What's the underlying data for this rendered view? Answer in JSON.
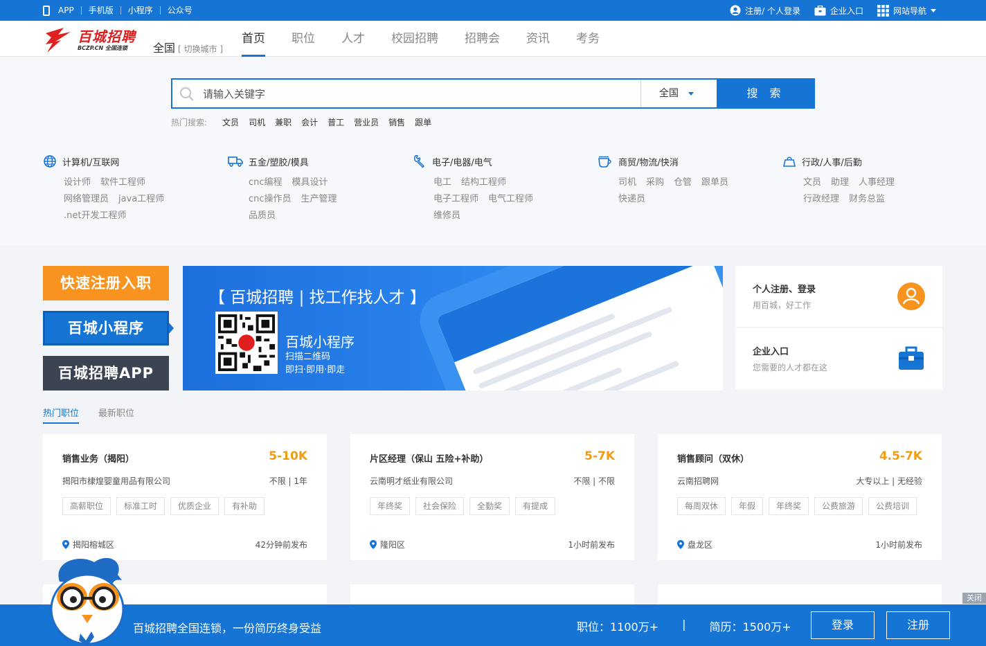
{
  "topbar": {
    "links": [
      "APP",
      "手机版",
      "小程序",
      "公众号"
    ],
    "register_login": "注册/ 个人登录",
    "enterprise": "企业入口",
    "site_nav": "网站导航"
  },
  "header": {
    "logo_text": "百城招聘",
    "logo_sub": "BCZP.CN 全国连锁",
    "city": "全国",
    "switch_city": "[ 切换城市 ]",
    "nav": [
      "首页",
      "职位",
      "人才",
      "校园招聘",
      "招聘会",
      "资讯",
      "考务"
    ]
  },
  "search": {
    "placeholder": "请输入关键字",
    "city": "全国",
    "button": "搜 索",
    "hot_label": "热门搜索:",
    "hot_words": [
      "文员",
      "司机",
      "兼职",
      "会计",
      "普工",
      "营业员",
      "销售",
      "跟单"
    ]
  },
  "categories": [
    {
      "title": "计算机/互联网",
      "icon": "globe-icon",
      "subs": [
        [
          "设计师",
          "软件工程师"
        ],
        [
          "网络管理员",
          "java工程师"
        ],
        [
          ".net开发工程师"
        ]
      ]
    },
    {
      "title": "五金/塑胶/模具",
      "icon": "truck-icon",
      "subs": [
        [
          "cnc编程",
          "模具设计"
        ],
        [
          "cnc操作员",
          "生产管理"
        ],
        [
          "品质员"
        ]
      ]
    },
    {
      "title": "电子/电器/电气",
      "icon": "wrench-icon",
      "subs": [
        [
          "电工",
          "结构工程师"
        ],
        [
          "电子工程师",
          "电气工程师"
        ],
        [
          "维修员"
        ]
      ]
    },
    {
      "title": "商贸/物流/快消",
      "icon": "cup-icon",
      "subs": [
        [
          "司机",
          "采购",
          "仓管",
          "跟单员"
        ],
        [
          "快递员"
        ]
      ]
    },
    {
      "title": "行政/人事/后勤",
      "icon": "bag-icon",
      "subs": [
        [
          "文员",
          "助理",
          "人事经理"
        ],
        [
          "行政经理",
          "财务总监"
        ]
      ]
    }
  ],
  "promo": {
    "quick_register": "快速注册入职",
    "mini_program": "百城小程序",
    "app": "百城招聘APP"
  },
  "banner": {
    "title": "【 百城招聘 | 找工作找人才 】",
    "subtitle": "百城小程序",
    "desc1": "扫描二维码",
    "desc2": "即扫·即用·即走"
  },
  "entries": {
    "personal_title": "个人注册、登录",
    "personal_sub": "用百城，好工作",
    "company_title": "企业入口",
    "company_sub": "您需要的人才都在这"
  },
  "tabs": [
    "热门职位",
    "最新职位"
  ],
  "jobs": [
    {
      "title": "销售业务（揭阳）",
      "salary": "5-10K",
      "company": "揭阳市棣煌婴童用品有限公司",
      "req": "不限 | 1年",
      "tags": [
        "高薪职位",
        "标准工时",
        "优质企业",
        "有补助"
      ],
      "location": "揭阳榕城区",
      "time": "42分钟前发布"
    },
    {
      "title": "片区经理（保山 五险+补助）",
      "salary": "5-7K",
      "company": "云南明才纸业有限公司",
      "req": "不限 | 不限",
      "tags": [
        "年终奖",
        "社会保险",
        "全勤奖",
        "有提成"
      ],
      "location": "隆阳区",
      "time": "1小时前发布"
    },
    {
      "title": "销售顾问（双休）",
      "salary": "4.5-7K",
      "company": "云南招聘网",
      "req": "大专以上 | 无经验",
      "tags": [
        "每周双休",
        "年假",
        "年终奖",
        "公费旅游",
        "公费培训"
      ],
      "location": "盘龙区",
      "time": "1小时前发布"
    }
  ],
  "bottombar": {
    "slogan": "百城招聘全国连锁，一份简历终身受益",
    "jobs_stat": "职位：1100万+",
    "sep": "|",
    "resume_stat": "简历：1500万+",
    "login": "登录",
    "register": "注册",
    "close": "关闭"
  },
  "colors": {
    "primary": "#1574d4",
    "orange": "#f39c12",
    "promo_orange": "#f7931e",
    "dark": "#3d4451"
  }
}
